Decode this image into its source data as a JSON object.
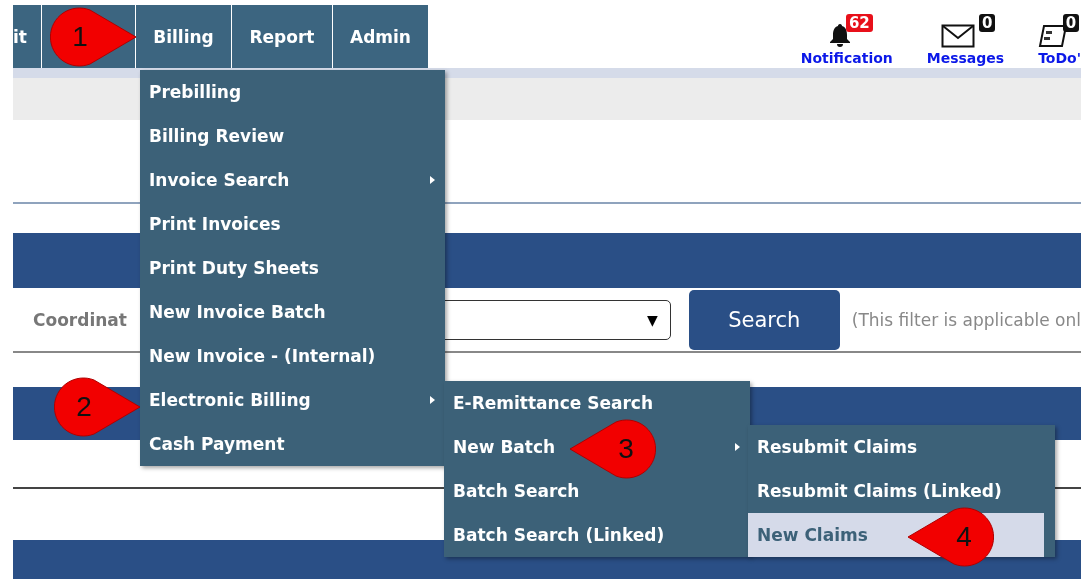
{
  "nav_tabs": [
    {
      "kind": "text",
      "label": "it"
    },
    {
      "kind": "covered"
    },
    {
      "kind": "text",
      "label": "Billing"
    },
    {
      "kind": "text",
      "label": "Report"
    },
    {
      "kind": "text",
      "label": "Admin"
    }
  ],
  "header_links": [
    {
      "kind": "bell",
      "label": "Notification",
      "badge": "62",
      "color": "#e8101a"
    },
    {
      "kind": "envelope",
      "label": "Messages",
      "badge": "0",
      "color": "#111111"
    },
    {
      "kind": "todo",
      "label": "ToDo'",
      "badge": "0",
      "color": "#111111"
    }
  ],
  "filter": {
    "label": "Coordinat",
    "dropdown_arrow": "▼",
    "search_button": "Search",
    "hint": "(This filter is applicable onl"
  },
  "menus": [
    {
      "items": [
        {
          "label": "Prebilling",
          "submenu": false,
          "selected": false
        },
        {
          "label": "Billing Review",
          "submenu": false,
          "selected": false
        },
        {
          "label": "Invoice Search",
          "submenu": true,
          "selected": false
        },
        {
          "label": "Print Invoices",
          "submenu": false,
          "selected": false
        },
        {
          "label": "Print Duty Sheets",
          "submenu": false,
          "selected": false
        },
        {
          "label": "New Invoice Batch",
          "submenu": false,
          "selected": false
        },
        {
          "label": "New Invoice - (Internal)",
          "submenu": false,
          "selected": false
        },
        {
          "label": "Electronic Billing",
          "submenu": true,
          "selected": false
        },
        {
          "label": "Cash Payment",
          "submenu": false,
          "selected": false
        }
      ]
    },
    {
      "items": [
        {
          "label": "E-Remittance Search",
          "submenu": false,
          "selected": false
        },
        {
          "label": "New Batch",
          "submenu": true,
          "selected": false
        },
        {
          "label": "Batch Search",
          "submenu": false,
          "selected": false
        },
        {
          "label": "Batch Search (Linked)",
          "submenu": false,
          "selected": false
        }
      ]
    },
    {
      "items": [
        {
          "label": "Resubmit Claims",
          "submenu": false,
          "selected": false
        },
        {
          "label": "Resubmit Claims (Linked)",
          "submenu": false,
          "selected": false
        },
        {
          "label": "New Claims",
          "submenu": false,
          "selected": true
        }
      ]
    }
  ],
  "callouts": [
    {
      "number": "1",
      "kind": "right"
    },
    {
      "number": "2",
      "kind": "right"
    },
    {
      "number": "3",
      "kind": "left"
    },
    {
      "number": "4",
      "kind": "left"
    }
  ]
}
